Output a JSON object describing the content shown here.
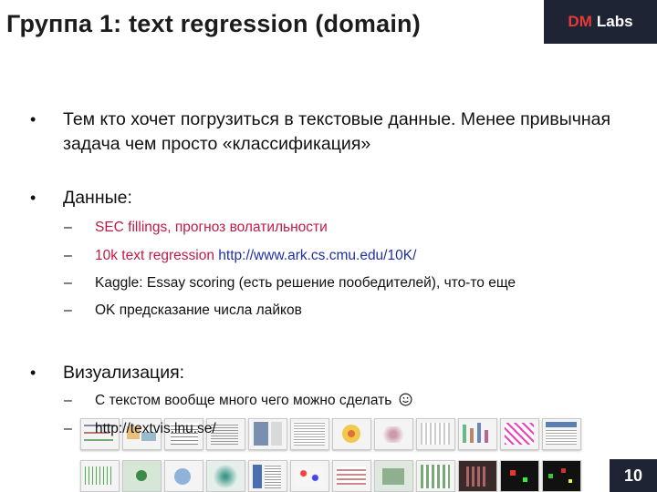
{
  "slide": {
    "title": "Группа 1: text regression (domain)",
    "logo": {
      "dm": "DM",
      "labs": "Labs"
    },
    "page_number": "10"
  },
  "bullets": [
    {
      "text": "Тем кто хочет погрузиться в текстовые данные. Менее привычная задача чем просто «классификация»"
    },
    {
      "text": "Данные:",
      "items": [
        {
          "text": "SEC fillings, прогноз волатильности"
        },
        {
          "text": "10k text regression",
          "link": "http://www.ark.cs.cmu.edu/10K/"
        },
        {
          "text": "Kaggle: Essay scoring (есть решение пообедителей), что-то еще"
        },
        {
          "text": "OK предсказание числа лайков"
        }
      ]
    },
    {
      "text": "Визуализация:",
      "items": [
        {
          "text": "С текстом вообще много чего можно сделать",
          "icon": "smiley-icon"
        },
        {
          "text": "http://textvis.lnu.se/"
        }
      ]
    }
  ],
  "colors": {
    "accent_red": "#c01a45",
    "link_blue": "#1f2fa8",
    "dark_navy": "#1e2433"
  }
}
